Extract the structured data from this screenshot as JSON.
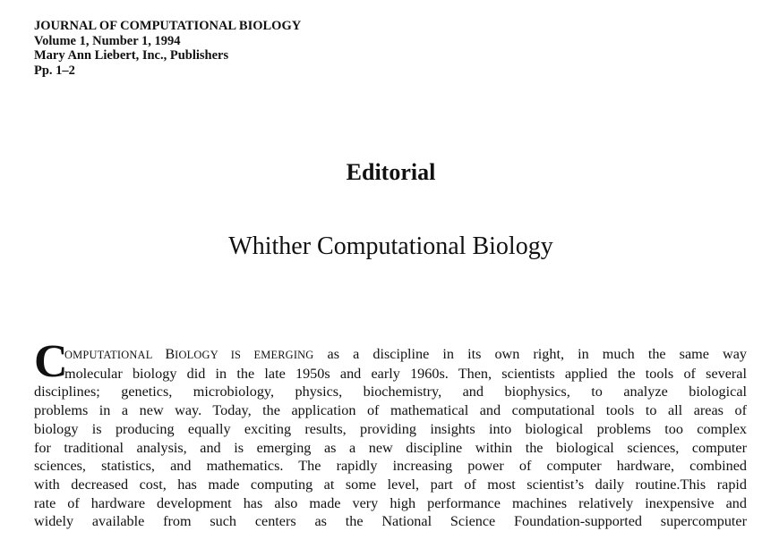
{
  "header": {
    "journal": "JOURNAL OF COMPUTATIONAL BIOLOGY",
    "volume": "Volume 1, Number 1, 1994",
    "publisher": "Mary Ann Liebert, Inc., Publishers",
    "pages": "Pp. 1–2"
  },
  "section_title": "Editorial",
  "article_title": "Whither Computational Biology",
  "body": {
    "dropcap": "C",
    "lead_smallcaps_1": "OMPUTATIONAL ",
    "lead_B": "B",
    "lead_smallcaps_2": "IOLOGY IS EMERGING",
    "line1_rest": " as a discipline in its own right, in much the same way",
    "lines": [
      "molecular biology did in the late 1950s and early 1960s. Then, scientists applied the tools of several",
      "disciplines; genetics, microbiology, physics, biochemistry, and biophysics, to analyze biological",
      "problems in a new way. Today, the application of mathematical and computational tools to all areas of",
      "biology is producing equally exciting results, providing insights into biological problems too complex",
      "for traditional analysis, and is emerging as a new discipline within the biological sciences, computer",
      "sciences, statistics, and mathematics. The rapidly increasing power of computer hardware, combined",
      "with decreased cost, has made computing at some level, part of most scientist’s daily routine.This rapid",
      "rate of hardware development has also made very high performance machines relatively inexpensive and",
      "widely available from such centers as the National Science Foundation-supported supercomputer"
    ]
  }
}
